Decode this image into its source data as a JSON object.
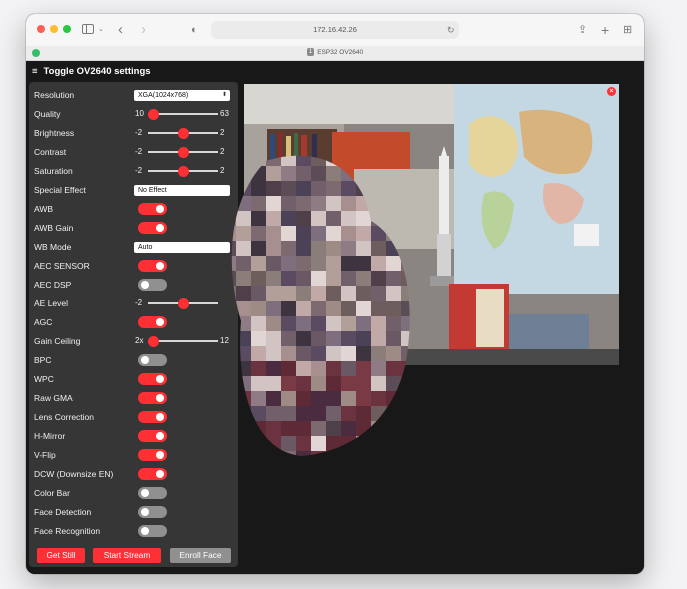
{
  "browser": {
    "address": "172.16.42.26",
    "tab_title": "ESP32 OV2640",
    "tab_number": "1"
  },
  "page": {
    "header": "Toggle OV2640 settings",
    "hamburger": "≡"
  },
  "settings": {
    "resolution": {
      "label": "Resolution",
      "value": "XGA(1024x768)"
    },
    "quality": {
      "label": "Quality",
      "min": "10",
      "max": "63",
      "value": 10,
      "range": [
        10,
        63
      ]
    },
    "brightness": {
      "label": "Brightness",
      "min": "-2",
      "max": "2",
      "value": 0,
      "range": [
        -2,
        2
      ]
    },
    "contrast": {
      "label": "Contrast",
      "min": "-2",
      "max": "2",
      "value": 0,
      "range": [
        -2,
        2
      ]
    },
    "saturation": {
      "label": "Saturation",
      "min": "-2",
      "max": "2",
      "value": 0,
      "range": [
        -2,
        2
      ]
    },
    "special_effect": {
      "label": "Special Effect",
      "value": "No Effect"
    },
    "awb": {
      "label": "AWB",
      "on": true
    },
    "awb_gain": {
      "label": "AWB Gain",
      "on": true
    },
    "wb_mode": {
      "label": "WB Mode",
      "value": "Auto"
    },
    "aec_sensor": {
      "label": "AEC SENSOR",
      "on": true
    },
    "aec_dsp": {
      "label": "AEC DSP",
      "on": false
    },
    "ae_level": {
      "label": "AE Level",
      "min": "-2",
      "value": 0,
      "range": [
        -2,
        2
      ]
    },
    "agc": {
      "label": "AGC",
      "on": true
    },
    "gain_ceiling": {
      "label": "Gain Ceiling",
      "min": "2x",
      "max": "12",
      "value": 0,
      "range": [
        0,
        6
      ]
    },
    "bpc": {
      "label": "BPC",
      "on": false
    },
    "wpc": {
      "label": "WPC",
      "on": true
    },
    "raw_gma": {
      "label": "Raw GMA",
      "on": true
    },
    "lens_correction": {
      "label": "Lens Correction",
      "on": true
    },
    "h_mirror": {
      "label": "H-Mirror",
      "on": true
    },
    "v_flip": {
      "label": "V-Flip",
      "on": true
    },
    "dcw": {
      "label": "DCW (Downsize EN)",
      "on": true
    },
    "color_bar": {
      "label": "Color Bar",
      "on": false
    },
    "face_detection": {
      "label": "Face Detection",
      "on": false
    },
    "face_recognition": {
      "label": "Face Recognition",
      "on": false
    }
  },
  "buttons": {
    "get_still": "Get Still",
    "start_stream": "Start Stream",
    "enroll_face": "Enroll Face"
  },
  "stream": {
    "close": "×"
  },
  "colors": {
    "accent": "#ff3034",
    "toggle_off": "#909090",
    "panel": "#363636",
    "page_bg": "#181818"
  }
}
